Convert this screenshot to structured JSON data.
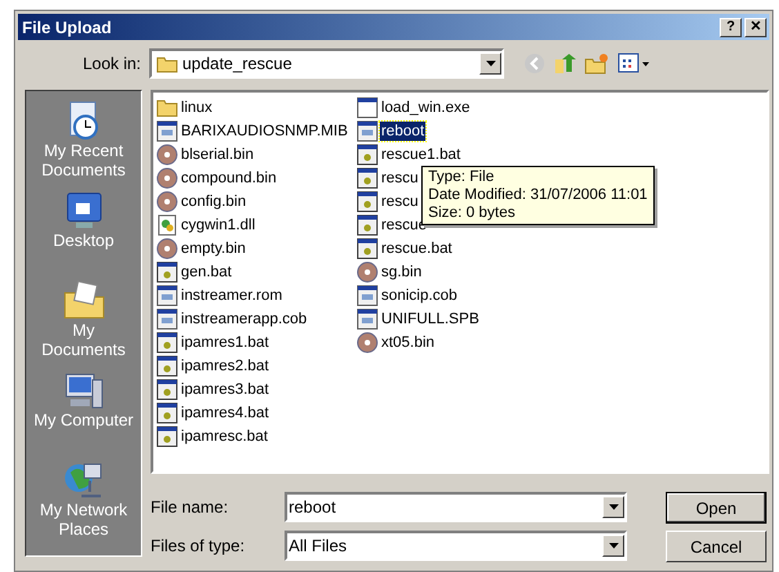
{
  "window": {
    "title": "File Upload",
    "controls": [
      "?",
      "✕"
    ]
  },
  "look_in": {
    "label": "Look in:",
    "value": "update_rescue"
  },
  "places": [
    {
      "label": "My Recent Documents",
      "kind": "recent"
    },
    {
      "label": "Desktop",
      "kind": "desktop"
    },
    {
      "label": "My Documents",
      "kind": "documents"
    },
    {
      "label": "My Computer",
      "kind": "computer"
    },
    {
      "label": "My Network Places",
      "kind": "network"
    }
  ],
  "files": [
    {
      "name": "linux",
      "kind": "folder",
      "selected": false
    },
    {
      "name": "BARIXAUDIOSNMP.MIB",
      "kind": "file",
      "selected": false
    },
    {
      "name": "blserial.bin",
      "kind": "disc",
      "selected": false
    },
    {
      "name": "compound.bin",
      "kind": "disc",
      "selected": false
    },
    {
      "name": "config.bin",
      "kind": "disc",
      "selected": false
    },
    {
      "name": "cygwin1.dll",
      "kind": "dll",
      "selected": false
    },
    {
      "name": "empty.bin",
      "kind": "disc",
      "selected": false
    },
    {
      "name": "gen.bat",
      "kind": "bat",
      "selected": false
    },
    {
      "name": "instreamer.rom",
      "kind": "file",
      "selected": false
    },
    {
      "name": "instreamerapp.cob",
      "kind": "file",
      "selected": false
    },
    {
      "name": "ipamres1.bat",
      "kind": "bat",
      "selected": false
    },
    {
      "name": "ipamres2.bat",
      "kind": "bat",
      "selected": false
    },
    {
      "name": "ipamres3.bat",
      "kind": "bat",
      "selected": false
    },
    {
      "name": "ipamres4.bat",
      "kind": "bat",
      "selected": false
    },
    {
      "name": "ipamresc.bat",
      "kind": "bat",
      "selected": false
    },
    {
      "name": "load_win.exe",
      "kind": "exe",
      "selected": false
    },
    {
      "name": "reboot",
      "kind": "file",
      "selected": true
    },
    {
      "name": "rescue1.bat",
      "kind": "bat",
      "selected": false
    },
    {
      "name": "rescu",
      "kind": "bat",
      "selected": false
    },
    {
      "name": "rescu",
      "kind": "bat",
      "selected": false
    },
    {
      "name": "rescue",
      "kind": "bat",
      "selected": false
    },
    {
      "name": "rescue.bat",
      "kind": "bat",
      "selected": false
    },
    {
      "name": "sg.bin",
      "kind": "disc",
      "selected": false
    },
    {
      "name": "sonicip.cob",
      "kind": "file",
      "selected": false
    },
    {
      "name": "UNIFULL.SPB",
      "kind": "file",
      "selected": false
    },
    {
      "name": "xt05.bin",
      "kind": "disc",
      "selected": false
    }
  ],
  "tooltip": [
    "Type: File",
    "Date Modified: 31/07/2006 11:01",
    "Size: 0 bytes"
  ],
  "file_name": {
    "label": "File name:",
    "value": "reboot"
  },
  "file_type": {
    "label": "Files of type:",
    "value": "All Files"
  },
  "buttons": [
    "Open",
    "Cancel"
  ]
}
